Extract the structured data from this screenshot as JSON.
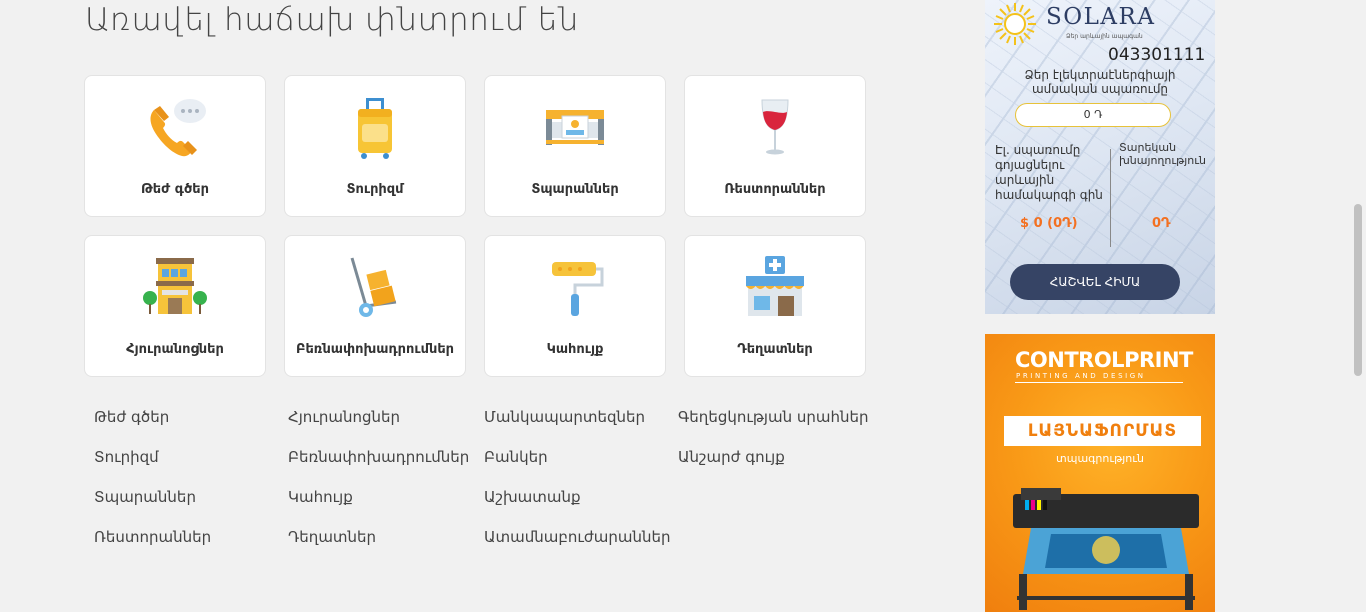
{
  "section": {
    "heading": "Առավել հաճախ փնտրում են"
  },
  "cards": [
    {
      "label": "Թեժ գծեր",
      "icon": "phone-icon"
    },
    {
      "label": "Տուրիզմ",
      "icon": "suitcase-icon"
    },
    {
      "label": "Տպարաններ",
      "icon": "printer-icon"
    },
    {
      "label": "Ռեստորաններ",
      "icon": "wine-glass-icon"
    },
    {
      "label": "Հյուրանոցներ",
      "icon": "hotel-icon"
    },
    {
      "label": "Բեռնափոխադրումներ",
      "icon": "hand-truck-icon"
    },
    {
      "label": "Կահույք",
      "icon": "paint-roller-icon"
    },
    {
      "label": "Դեղատներ",
      "icon": "pharmacy-icon"
    }
  ],
  "links": {
    "col1": [
      "Թեժ գծեր",
      "Տուրիզմ",
      "Տպարաններ",
      "Ռեստորաններ"
    ],
    "col2": [
      "Հյուրանոցներ",
      "Բեռնափոխադրումներ",
      "Կահույք",
      "Դեղատներ"
    ],
    "col3": [
      "Մանկապարտեզներ",
      "Բանկեր",
      "Աշխատանք",
      "Ատամնաբուժարաններ"
    ],
    "col4": [
      "Գեղեցկության սրահներ",
      "Անշարժ գույք"
    ]
  },
  "solar_widget": {
    "brand": "SOLARA",
    "brand_subtitle": "Ձեր արևային ապագան",
    "phone": "043301111",
    "consumption_label": "Ձեր էլեկտրաէներգիայի ամսական սպառումը",
    "consumption_value": "0 Դ",
    "left_label": "Էլ. սպառումը գոյացնելու արևային համակարգի գին",
    "right_label": "Տարեկան խնայողություն",
    "left_value": "$ 0 (0Դ)",
    "right_value": "0Դ",
    "button": "ՀԱՇՎԵԼ ՀԻՄԱ",
    "accent": "#f37021"
  },
  "print_ad": {
    "logo_part1": "CONTROL",
    "logo_part2": "PRINT",
    "logo_sub": "PRINTING AND DESIGN",
    "banner": "ԼԱՅՆԱՖՈՐՄԱՏ",
    "tagline": "տպագրություն"
  }
}
